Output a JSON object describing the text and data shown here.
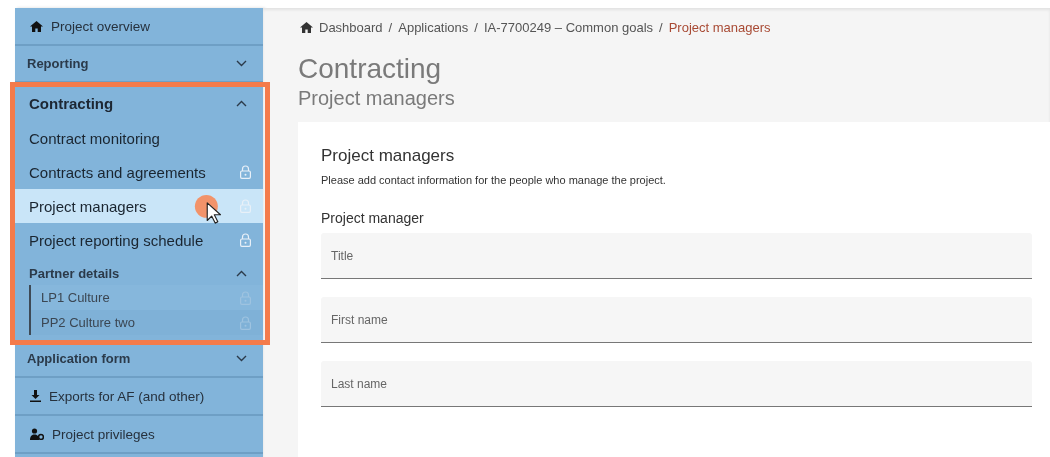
{
  "sidebar": {
    "items": [
      {
        "kind": "link",
        "label": "Project overview",
        "selected": false
      },
      {
        "kind": "section",
        "label": "Reporting",
        "expanded": false
      },
      {
        "kind": "group",
        "label": "Contracting",
        "expanded": true,
        "children": [
          {
            "kind": "item",
            "label": "Contract monitoring",
            "locked": false,
            "selected": false
          },
          {
            "kind": "item",
            "label": "Contracts and agreements",
            "locked": true,
            "selected": false
          },
          {
            "kind": "item",
            "label": "Project managers",
            "locked": true,
            "selected": true
          },
          {
            "kind": "item",
            "label": "Project reporting schedule",
            "locked": true,
            "selected": false
          },
          {
            "kind": "subgroup",
            "label": "Partner details",
            "expanded": true,
            "children": [
              {
                "kind": "subitem",
                "label": "LP1 Culture",
                "locked": true,
                "selected": false
              },
              {
                "kind": "subitem",
                "label": "PP2 Culture two",
                "locked": true,
                "selected": false
              }
            ]
          }
        ]
      },
      {
        "kind": "section",
        "label": "Application form",
        "expanded": false
      },
      {
        "kind": "link",
        "label": "Exports for AF (and other)",
        "selected": false
      },
      {
        "kind": "link",
        "label": "Project privileges",
        "selected": false
      }
    ]
  },
  "breadcrumb": {
    "separator": "/",
    "items": [
      "Dashboard",
      "Applications",
      "IA-7700249 – Common goals",
      "Project managers"
    ]
  },
  "page": {
    "title": "Contracting",
    "subtitle": "Project managers"
  },
  "card": {
    "title": "Project managers",
    "description": "Please add contact information for the people who manage the project.",
    "section_label": "Project manager",
    "fields": [
      {
        "placeholder": "Title"
      },
      {
        "placeholder": "First name"
      },
      {
        "placeholder": "Last name"
      }
    ]
  }
}
